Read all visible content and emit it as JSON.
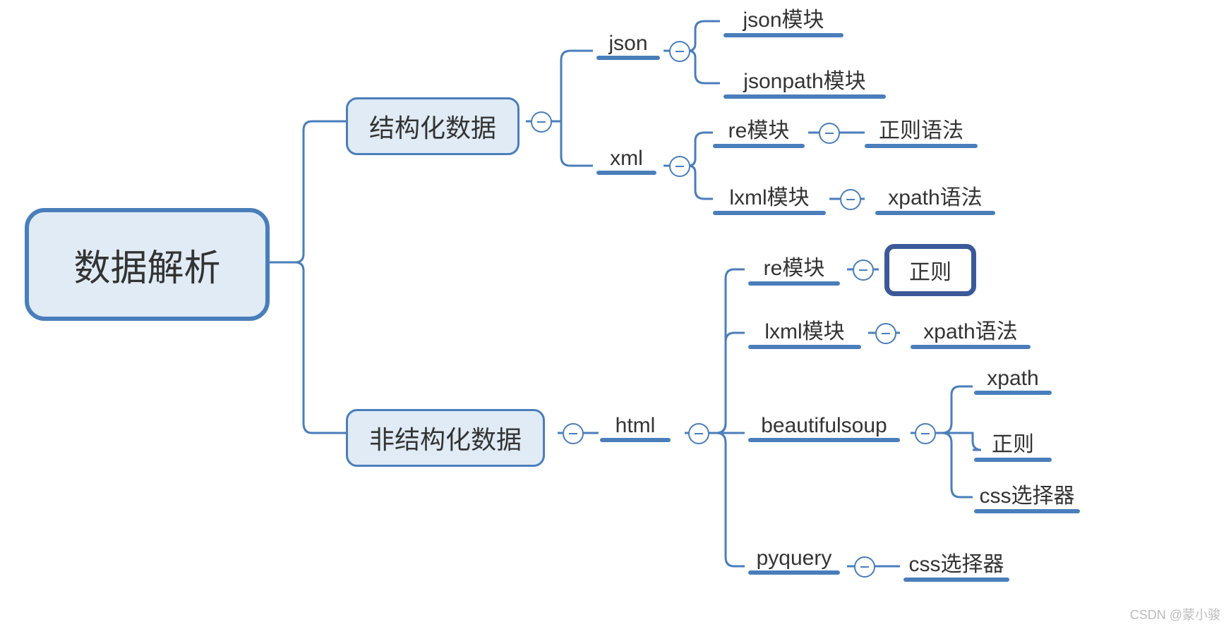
{
  "root": "数据解析",
  "l1": {
    "structured": "结构化数据",
    "unstructured": "非结构化数据"
  },
  "structured": {
    "json": {
      "label": "json",
      "children": {
        "jsonmod": "json模块",
        "jsonpath": "jsonpath模块"
      }
    },
    "xml": {
      "label": "xml",
      "children": {
        "re": {
          "label": "re模块",
          "sub": "正则语法"
        },
        "lxml": {
          "label": "lxml模块",
          "sub": "xpath语法"
        }
      }
    }
  },
  "unstructured": {
    "html": {
      "label": "html",
      "children": {
        "re": {
          "label": "re模块",
          "sub": "正则"
        },
        "lxml": {
          "label": "lxml模块",
          "sub": "xpath语法"
        },
        "bs": {
          "label": "beautifulsoup",
          "sub": {
            "xpath": "xpath",
            "regex": "正则",
            "css": "css选择器"
          }
        },
        "pyquery": {
          "label": "pyquery",
          "sub": "css选择器"
        }
      }
    }
  },
  "watermark": "CSDN @蒙小骏",
  "colors": {
    "border": "#4A7EBB",
    "fill": "#E0EBF5",
    "selected": "#3B5998"
  }
}
